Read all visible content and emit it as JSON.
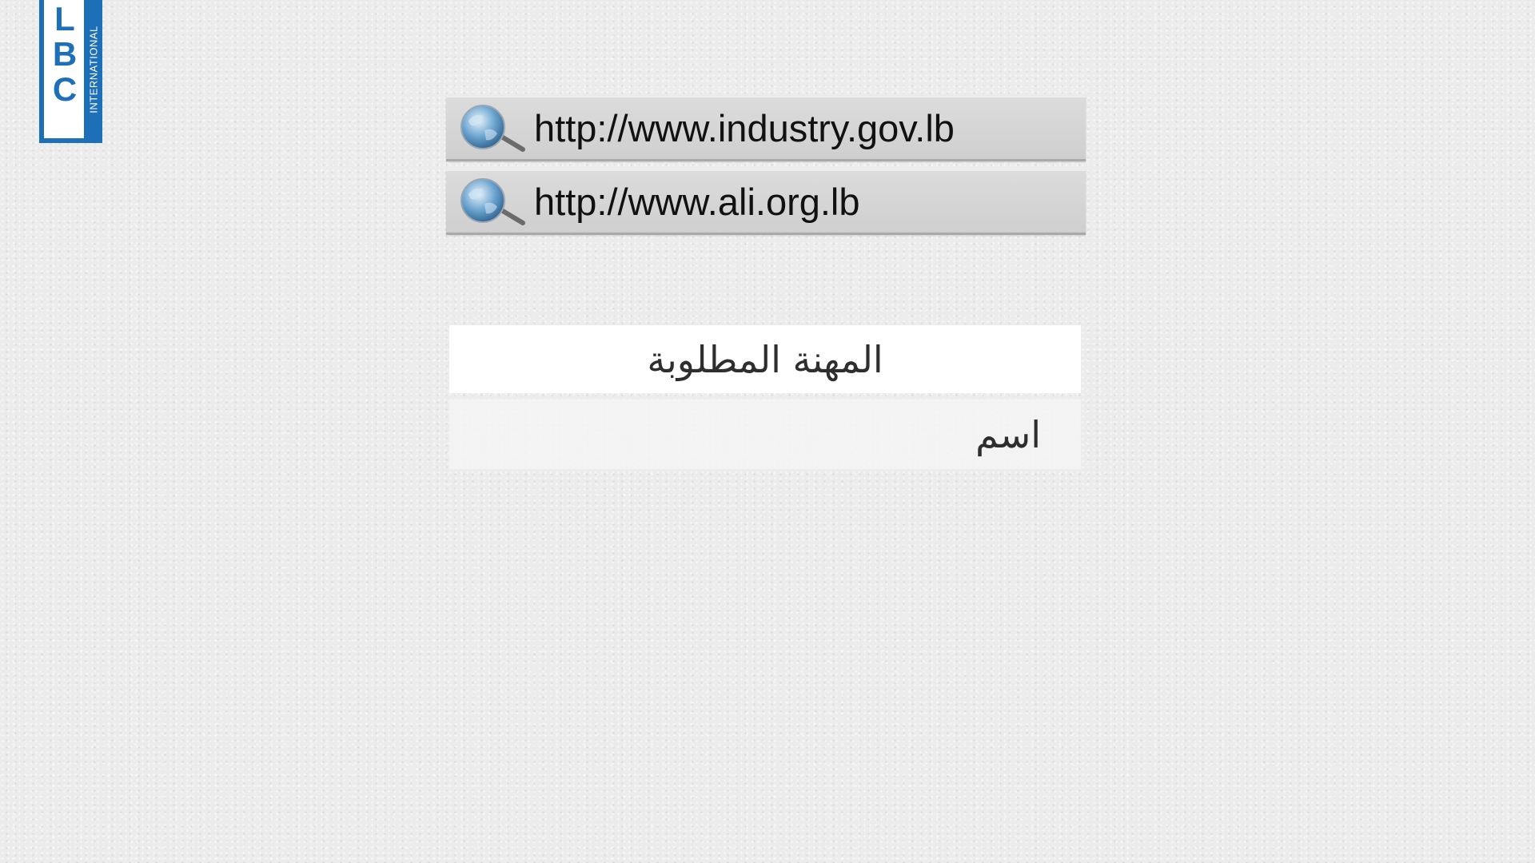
{
  "logo": {
    "letters": [
      "L",
      "B",
      "C"
    ],
    "side_text": "INTERNATIONAL",
    "color": "#1d6fb8"
  },
  "links": [
    {
      "icon": "globe-search-icon",
      "url": "http://www.industry.gov.lb"
    },
    {
      "icon": "globe-search-icon",
      "url": "http://www.ali.org.lb"
    }
  ],
  "table": {
    "header": "المهنة المطلوبة",
    "rows": [
      "اسم"
    ]
  }
}
